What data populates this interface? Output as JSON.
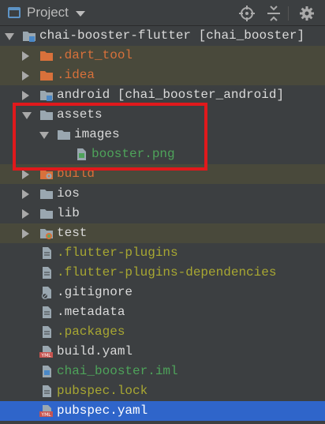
{
  "header": {
    "title": "Project"
  },
  "tree": [
    {
      "label": "chai-booster-flutter [chai_booster]",
      "icon": "module-folder-icon",
      "arrow": "down",
      "style": "white",
      "excluded": false,
      "selected": false
    },
    {
      "label": ".dart_tool",
      "icon": "folder-orange-icon",
      "arrow": "right",
      "style": "orange",
      "excluded": true,
      "selected": false
    },
    {
      "label": ".idea",
      "icon": "folder-orange-icon",
      "arrow": "right",
      "style": "orange",
      "excluded": true,
      "selected": false
    },
    {
      "label": "android [chai_booster_android]",
      "icon": "module-folder-icon",
      "arrow": "right",
      "style": "white",
      "excluded": false,
      "selected": false
    },
    {
      "label": "assets",
      "icon": "folder-icon",
      "arrow": "down",
      "style": "white",
      "excluded": false,
      "selected": false
    },
    {
      "label": "images",
      "icon": "folder-icon",
      "arrow": "down",
      "style": "white",
      "excluded": false,
      "selected": false
    },
    {
      "label": "booster.png",
      "icon": "image-file-icon",
      "arrow": "",
      "style": "green",
      "excluded": false,
      "selected": false
    },
    {
      "label": "build",
      "icon": "build-folder-icon",
      "arrow": "right",
      "style": "orange",
      "excluded": true,
      "selected": false
    },
    {
      "label": "ios",
      "icon": "folder-icon",
      "arrow": "right",
      "style": "white",
      "excluded": false,
      "selected": false
    },
    {
      "label": "lib",
      "icon": "folder-icon",
      "arrow": "right",
      "style": "white",
      "excluded": false,
      "selected": false
    },
    {
      "label": "test",
      "icon": "test-folder-icon",
      "arrow": "right",
      "style": "white",
      "excluded": true,
      "selected": false
    },
    {
      "label": ".flutter-plugins",
      "icon": "text-file-icon",
      "arrow": "",
      "style": "olive",
      "excluded": false,
      "selected": false
    },
    {
      "label": ".flutter-plugins-dependencies",
      "icon": "text-file-icon",
      "arrow": "",
      "style": "olive",
      "excluded": false,
      "selected": false
    },
    {
      "label": ".gitignore",
      "icon": "gitignore-file-icon",
      "arrow": "",
      "style": "white",
      "excluded": false,
      "selected": false
    },
    {
      "label": ".metadata",
      "icon": "text-file-icon",
      "arrow": "",
      "style": "white",
      "excluded": false,
      "selected": false
    },
    {
      "label": ".packages",
      "icon": "text-file-icon",
      "arrow": "",
      "style": "olive",
      "excluded": false,
      "selected": false
    },
    {
      "label": "build.yaml",
      "icon": "yaml-file-icon",
      "arrow": "",
      "style": "white",
      "excluded": false,
      "selected": false
    },
    {
      "label": "chai_booster.iml",
      "icon": "iml-file-icon",
      "arrow": "",
      "style": "green",
      "excluded": false,
      "selected": false
    },
    {
      "label": "pubspec.lock",
      "icon": "text-file-icon",
      "arrow": "",
      "style": "olive",
      "excluded": false,
      "selected": false
    },
    {
      "label": "pubspec.yaml",
      "icon": "yaml-file-icon",
      "arrow": "",
      "style": "selected-white",
      "excluded": false,
      "selected": true
    }
  ],
  "colors": {
    "background": "#3c3f41",
    "excluded_row": "#49493b",
    "selection": "#2f65ca",
    "highlight": "#e0191c"
  }
}
